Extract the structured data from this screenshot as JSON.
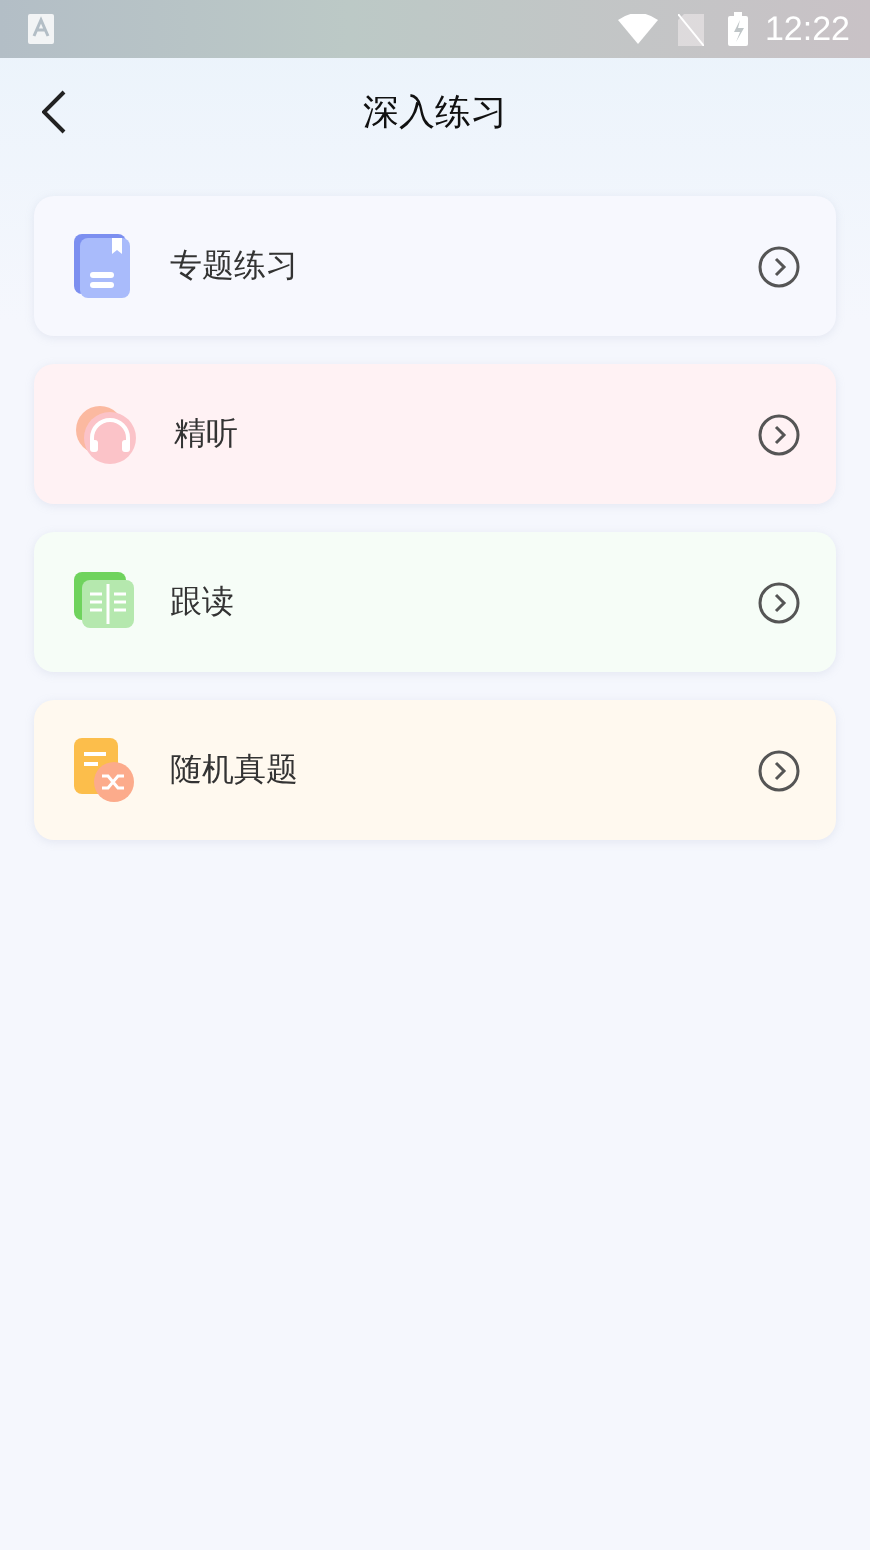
{
  "status_bar": {
    "time": "12:22"
  },
  "header": {
    "title": "深入练习"
  },
  "items": [
    {
      "label": "专题练习",
      "kind": "book",
      "color": "#f7f8fe"
    },
    {
      "label": "精听",
      "kind": "headphones",
      "color": "#fff2f4"
    },
    {
      "label": "跟读",
      "kind": "reading",
      "color": "#f6fdf7"
    },
    {
      "label": "随机真题",
      "kind": "shuffle",
      "color": "#fff9ef"
    }
  ]
}
